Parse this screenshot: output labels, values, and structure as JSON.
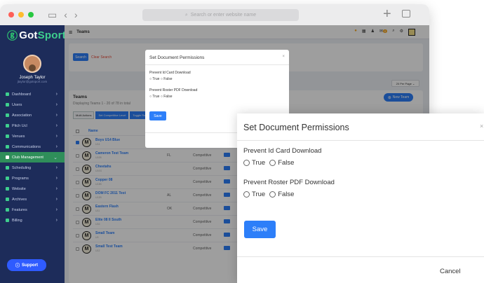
{
  "browser": {
    "address_placeholder": "Search or enter website name",
    "colors": {
      "close": "#fe5f57",
      "minimize": "#febc2e",
      "maximize": "#28c840"
    }
  },
  "app": {
    "brand_prefix": "Got",
    "brand_suffix": "Sport",
    "page_title": "Teams",
    "notification_count": "0"
  },
  "user": {
    "name": "Joseph Taylor",
    "email": "jtaylor@gotsport.com"
  },
  "sidebar": {
    "items": [
      {
        "label": "Dashboard"
      },
      {
        "label": "Users"
      },
      {
        "label": "Association"
      },
      {
        "label": "Pitch Ucl"
      },
      {
        "label": "Venues"
      },
      {
        "label": "Communications"
      },
      {
        "label": "Club Management"
      },
      {
        "label": "Scheduling"
      },
      {
        "label": "Programs"
      },
      {
        "label": "Website"
      },
      {
        "label": "Archives"
      },
      {
        "label": "Features"
      },
      {
        "label": "Billing"
      }
    ],
    "support_label": "Support"
  },
  "search": {
    "search_label": "Search",
    "clear_label": "Clear Search"
  },
  "per_page": "20 Per Page",
  "teams": {
    "title": "Teams",
    "subtitle": "Displaying Teams 1 - 20 of 78 in total",
    "new_team_label": "New Team",
    "filters": [
      "Multi Actions",
      "Set Competitive Level",
      "Toggle Roster"
    ],
    "name_header": "Name",
    "rows": [
      {
        "name": "Boys U14 Blue",
        "sub": "U14",
        "state": "",
        "level": "Competitive",
        "checked": true
      },
      {
        "name": "Cameron Test Team",
        "sub": "U10B",
        "state": "FL",
        "level": "Competitive",
        "checked": false
      },
      {
        "name": "Cheetahs",
        "sub": "U10G",
        "state": "",
        "level": "Competitive",
        "checked": false
      },
      {
        "name": "Copper 08",
        "sub": "U13B",
        "state": "",
        "level": "Competitive",
        "checked": false
      },
      {
        "name": "DOM FC 2011 Test",
        "sub": "U12B",
        "state": "AL",
        "level": "Competitive",
        "checked": false
      },
      {
        "name": "Eastern Flash",
        "sub": "U11",
        "state": "OK",
        "level": "Competitive",
        "checked": false
      },
      {
        "name": "Elite 08 II South",
        "sub": "U16",
        "state": "",
        "level": "Competitive",
        "checked": false
      },
      {
        "name": "Small Team",
        "sub": "U9",
        "state": "",
        "level": "Competitive",
        "checked": false
      },
      {
        "name": "Small Test Team",
        "sub": "U12",
        "state": "",
        "level": "Competitive",
        "checked": false
      }
    ]
  },
  "modal": {
    "title": "Set Document Permissions",
    "close_glyph": "×",
    "id_card_label": "Prevent Id Card Download",
    "roster_label": "Prevent Roster PDF Download",
    "true_label": "True",
    "false_label": "False",
    "save_label": "Save",
    "cancel_label": "Cancel"
  }
}
